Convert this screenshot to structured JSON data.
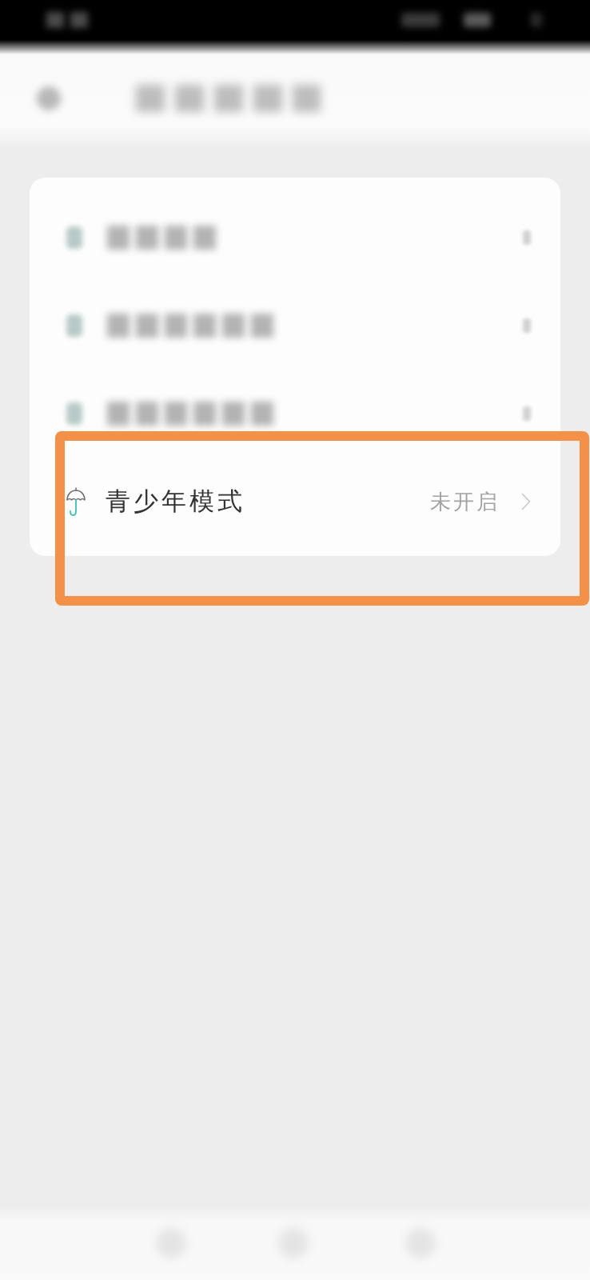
{
  "status_bar": {
    "kind": "blurred"
  },
  "header": {
    "kind": "blurred"
  },
  "settings_card": {
    "rows": [
      {
        "kind": "blurred"
      },
      {
        "kind": "blurred"
      },
      {
        "kind": "blurred"
      },
      {
        "kind": "entry",
        "label": "青少年模式",
        "value": "未开启"
      }
    ]
  },
  "nav_bar": {
    "kind": "blurred"
  },
  "annotations": [
    {
      "kind": "frame"
    }
  ]
}
